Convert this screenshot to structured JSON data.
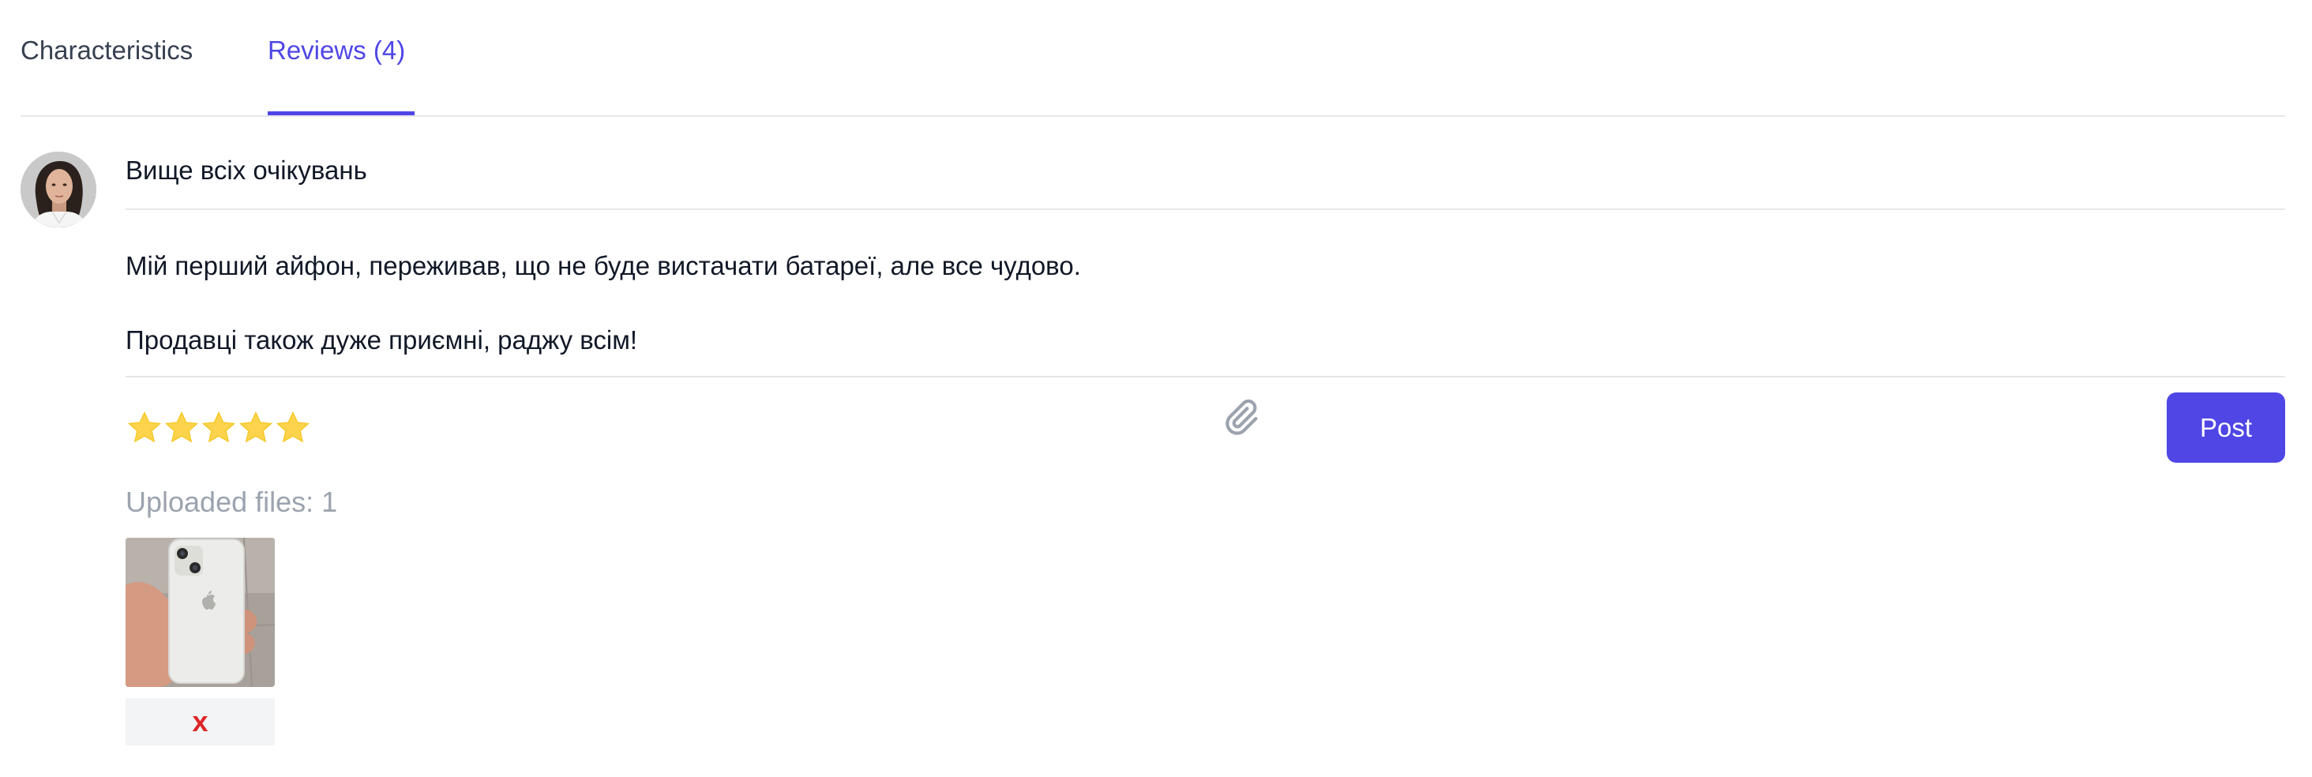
{
  "tabs": [
    {
      "label": "Characteristics",
      "active": false
    },
    {
      "label": "Reviews (4)",
      "active": true
    }
  ],
  "review": {
    "title": "Вище всіх очікувань",
    "body_lines": [
      "Мій перший айфон, переживав, що не буде вистачати батареї, але все чудово.",
      "Продавці також дуже приємні, раджу всім!"
    ],
    "rating": 5,
    "rating_max": 5
  },
  "toolbar": {
    "post_label": "Post",
    "attach_icon": "paperclip-icon"
  },
  "uploads": {
    "label": "Uploaded files: 1",
    "remove_label": "x"
  },
  "colors": {
    "accent": "#4f46e5",
    "star": "#fcd34d",
    "remove": "#dc2626",
    "muted": "#9ca3af"
  }
}
